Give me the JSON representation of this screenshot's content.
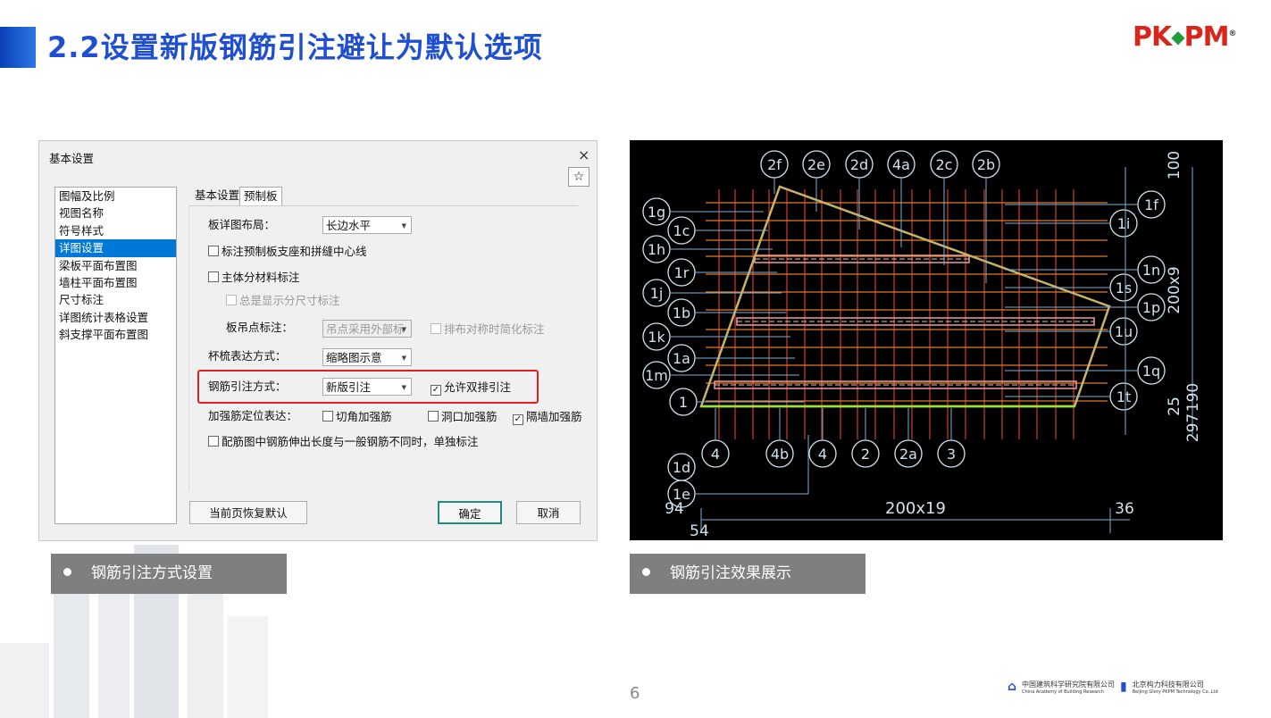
{
  "slide": {
    "title": "2.2设置新版钢筋引注避让为默认选项",
    "logo_p": "P",
    "logo_k": "K",
    "logo_mark": "◆",
    "logo_pm": "PM",
    "logo_reg": "®",
    "page_number": "6",
    "footer_org1": "中国建筑科学研究院有限公司",
    "footer_org1_en": "China Academy of Building Research",
    "footer_org2": "北京构力科技有限公司",
    "footer_org2_en": "Beijing Glory PKPM Technology Co.,Ltd",
    "caption_left": "钢筋引注方式设置",
    "caption_right": "钢筋引注效果展示"
  },
  "dialog": {
    "title": "基本设置",
    "close": "×",
    "star": "☆",
    "nav_items": [
      "图幅及比例",
      "视图名称",
      "符号样式",
      "详图设置",
      "梁板平面布置图",
      "墙柱平面布置图",
      "尺寸标注",
      "详图统计表格设置",
      "斜支撑平面布置图"
    ],
    "selected_index": 3,
    "tabs": [
      "基本设置",
      "预制板"
    ],
    "layout_label": "板详图布局：",
    "layout_value": "长边水平",
    "cb_support": "标注预制板支座和拼缝中心线",
    "cb_material": "主体分材料标注",
    "cb_always": "总是显示分尺寸标注",
    "hoist_label": "板吊点标注：",
    "hoist_value": "吊点采用外部标",
    "cb_symmetric": "排布对称时简化标注",
    "cup_label": "杯梳表达方式：",
    "cup_value": "缩略图示意",
    "rebar_label": "钢筋引注方式：",
    "rebar_value": "新版引注",
    "cb_double": "允许双排引注",
    "reinforce_label": "加强筋定位表达：",
    "cb_corner": "切角加强筋",
    "cb_hole": "洞口加强筋",
    "cb_wall": "隔墙加强筋",
    "cb_extend": "配筋图中钢筋伸出长度与一般钢筋不同时，单独标注",
    "btn_restore": "当前页恢复默认",
    "btn_ok": "确定",
    "btn_cancel": "取消",
    "checks": {
      "support": false,
      "material": false,
      "always": false,
      "symmetric": false,
      "double": true,
      "corner": false,
      "hole": false,
      "wall": true,
      "extend": false
    }
  },
  "cad": {
    "top_bubbles": [
      "2f",
      "2e",
      "2d",
      "4a",
      "2c",
      "2b"
    ],
    "left_bubbles": [
      "1g",
      "1c",
      "1h",
      "1r",
      "1j",
      "1b",
      "1k",
      "1a",
      "1m",
      "1"
    ],
    "right_bubbles": [
      "1f",
      "1i",
      "1n",
      "1s",
      "1p",
      "1u",
      "1q",
      "1t"
    ],
    "bottom_bubbles": [
      "4",
      "4b",
      "4",
      "2",
      "2a",
      "3"
    ],
    "lower_left_bubbles": [
      "1d",
      "1e"
    ],
    "dims": {
      "right_top": "100",
      "right_mid": "200x9",
      "right_small": "25",
      "right_bottom": "297",
      "right_bottom2": "190",
      "bottom_main": "200x19",
      "bottom_left": "94",
      "bottom_left2": "54",
      "bottom_right": "36"
    },
    "colors": {
      "background": "#000000",
      "bubble": "#cfe3ef",
      "rebar_red": "#c0392b",
      "rebar_orange": "#e07b2c",
      "outline": "#c9b26a",
      "edge_green": "#9be23a",
      "leader": "#7fb0d6"
    }
  }
}
